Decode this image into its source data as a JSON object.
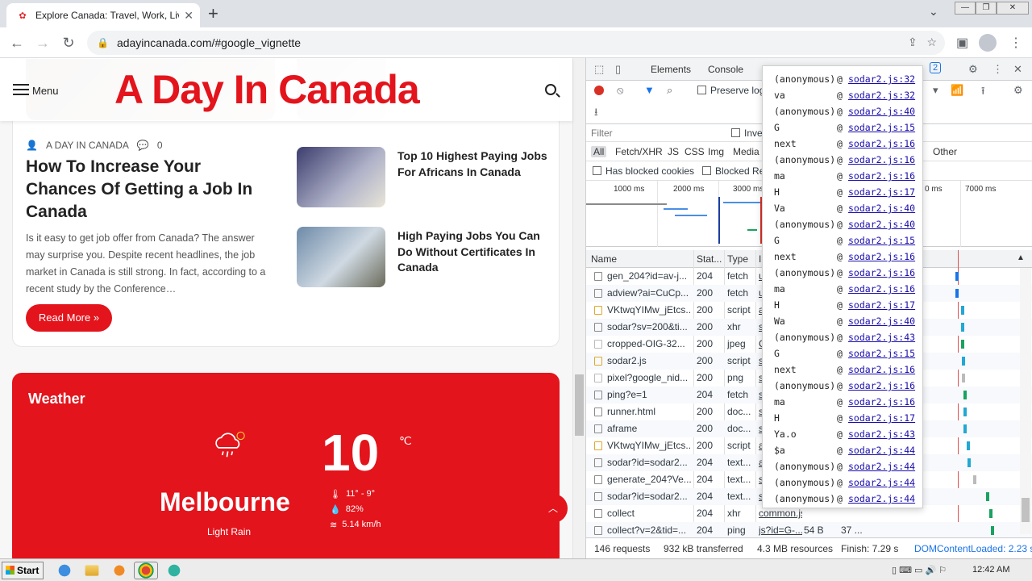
{
  "browser": {
    "tab_title": "Explore Canada: Travel, Work, Live,",
    "tab_close": "✕",
    "new_tab": "+",
    "url": "adayincanada.com/#google_vignette"
  },
  "site": {
    "menu_label": "Menu",
    "logo": "A Day In Canada",
    "post": {
      "author": "A DAY IN CANADA",
      "comments": "0",
      "title": "How To Increase Your Chances Of Getting a Job In Canada",
      "excerpt": "Is it easy to get job offer from Canada? The answer may surprise you. Despite recent headlines, the job market in Canada is still strong. In fact, according to a recent study by the Conference…",
      "read_more": "Read More »"
    },
    "side_posts": [
      {
        "title": "Top 10 Highest Paying Jobs For Africans In Canada"
      },
      {
        "title": "High Paying Jobs You Can Do Without Certificates In Canada"
      }
    ],
    "weather": {
      "title": "Weather",
      "temp": "10",
      "unit": "℃",
      "city": "Melbourne",
      "desc": "Light Rain",
      "range": "11° - 9°",
      "humidity": "82%",
      "wind": "5.14 km/h"
    }
  },
  "devtools": {
    "tabs": [
      "Elements",
      "Console"
    ],
    "badge": "2",
    "preserve_log": "Preserve log",
    "filter_placeholder": "Filter",
    "invert": "Inve",
    "types": [
      "All",
      "Fetch/XHR",
      "JS",
      "CSS",
      "Img",
      "Media",
      "Other"
    ],
    "blocked_cookies": "Has blocked cookies",
    "blocked_requests": "Blocked Re",
    "overview_labels": [
      "1000 ms",
      "2000 ms",
      "3000 ms",
      "0 ms",
      "7000 ms"
    ],
    "columns": [
      "Name",
      "Stat...",
      "Type",
      "I"
    ],
    "requests": [
      {
        "name": "gen_204?id=av-j...",
        "status": "204",
        "type": "fetch",
        "init": "u"
      },
      {
        "name": "adview?ai=CuCp...",
        "status": "200",
        "type": "fetch",
        "init": "u"
      },
      {
        "name": "VKtwqYIMw_jEtcs...",
        "status": "200",
        "type": "script",
        "init": "a"
      },
      {
        "name": "sodar?sv=200&ti...",
        "status": "200",
        "type": "xhr",
        "init": "s"
      },
      {
        "name": "cropped-OIG-32...",
        "status": "200",
        "type": "jpeg",
        "init": "C"
      },
      {
        "name": "sodar2.js",
        "status": "200",
        "type": "script",
        "init": "s"
      },
      {
        "name": "pixel?google_nid...",
        "status": "200",
        "type": "png",
        "init": "s"
      },
      {
        "name": "ping?e=1",
        "status": "204",
        "type": "fetch",
        "init": "s"
      },
      {
        "name": "runner.html",
        "status": "200",
        "type": "doc...",
        "init": "s"
      },
      {
        "name": "aframe",
        "status": "200",
        "type": "doc...",
        "init": "s"
      },
      {
        "name": "VKtwqYIMw_jEtcs...",
        "status": "200",
        "type": "script",
        "init": "a"
      },
      {
        "name": "sodar?id=sodar2...",
        "status": "204",
        "type": "text...",
        "init": "a"
      },
      {
        "name": "generate_204?Ve...",
        "status": "204",
        "type": "text...",
        "init": "s"
      },
      {
        "name": "sodar?id=sodar2...",
        "status": "204",
        "type": "text...",
        "init": "s"
      },
      {
        "name": "collect",
        "status": "204",
        "type": "xhr",
        "init": "common.js"
      },
      {
        "name": "collect?v=2&tid=...",
        "status": "204",
        "type": "ping",
        "init": "js?id=G-...",
        "size": "54 B",
        "time": "37 ..."
      }
    ],
    "status": {
      "requests": "146 requests",
      "transferred": "932 kB transferred",
      "resources": "4.3 MB resources",
      "finish": "Finish: 7.29 s",
      "dcl": "DOMContentLoaded: 2.23 s"
    },
    "stack": [
      {
        "fn": "(anonymous)",
        "loc": "sodar2.js:32"
      },
      {
        "fn": "va",
        "loc": "sodar2.js:32"
      },
      {
        "fn": "(anonymous)",
        "loc": "sodar2.js:40"
      },
      {
        "fn": "G",
        "loc": "sodar2.js:15"
      },
      {
        "fn": "next",
        "loc": "sodar2.js:16"
      },
      {
        "fn": "(anonymous)",
        "loc": "sodar2.js:16"
      },
      {
        "fn": "ma",
        "loc": "sodar2.js:16"
      },
      {
        "fn": "H",
        "loc": "sodar2.js:17"
      },
      {
        "fn": "Va",
        "loc": "sodar2.js:40"
      },
      {
        "fn": "(anonymous)",
        "loc": "sodar2.js:40"
      },
      {
        "fn": "G",
        "loc": "sodar2.js:15"
      },
      {
        "fn": "next",
        "loc": "sodar2.js:16"
      },
      {
        "fn": "(anonymous)",
        "loc": "sodar2.js:16"
      },
      {
        "fn": "ma",
        "loc": "sodar2.js:16"
      },
      {
        "fn": "H",
        "loc": "sodar2.js:17"
      },
      {
        "fn": "Wa",
        "loc": "sodar2.js:40"
      },
      {
        "fn": "(anonymous)",
        "loc": "sodar2.js:43"
      },
      {
        "fn": "G",
        "loc": "sodar2.js:15"
      },
      {
        "fn": "next",
        "loc": "sodar2.js:16"
      },
      {
        "fn": "(anonymous)",
        "loc": "sodar2.js:16"
      },
      {
        "fn": "ma",
        "loc": "sodar2.js:16"
      },
      {
        "fn": "H",
        "loc": "sodar2.js:17"
      },
      {
        "fn": "Ya.o",
        "loc": "sodar2.js:43"
      },
      {
        "fn": "$a",
        "loc": "sodar2.js:44"
      },
      {
        "fn": "(anonymous)",
        "loc": "sodar2.js:44"
      },
      {
        "fn": "(anonymous)",
        "loc": "sodar2.js:44"
      },
      {
        "fn": "(anonymous)",
        "loc": "sodar2.js:44"
      }
    ],
    "at_sign": "@"
  },
  "taskbar": {
    "start": "Start",
    "clock": "12:42 AM"
  },
  "colors": {
    "brand_red": "#e3141c",
    "link_blue": "#1a0dab"
  }
}
